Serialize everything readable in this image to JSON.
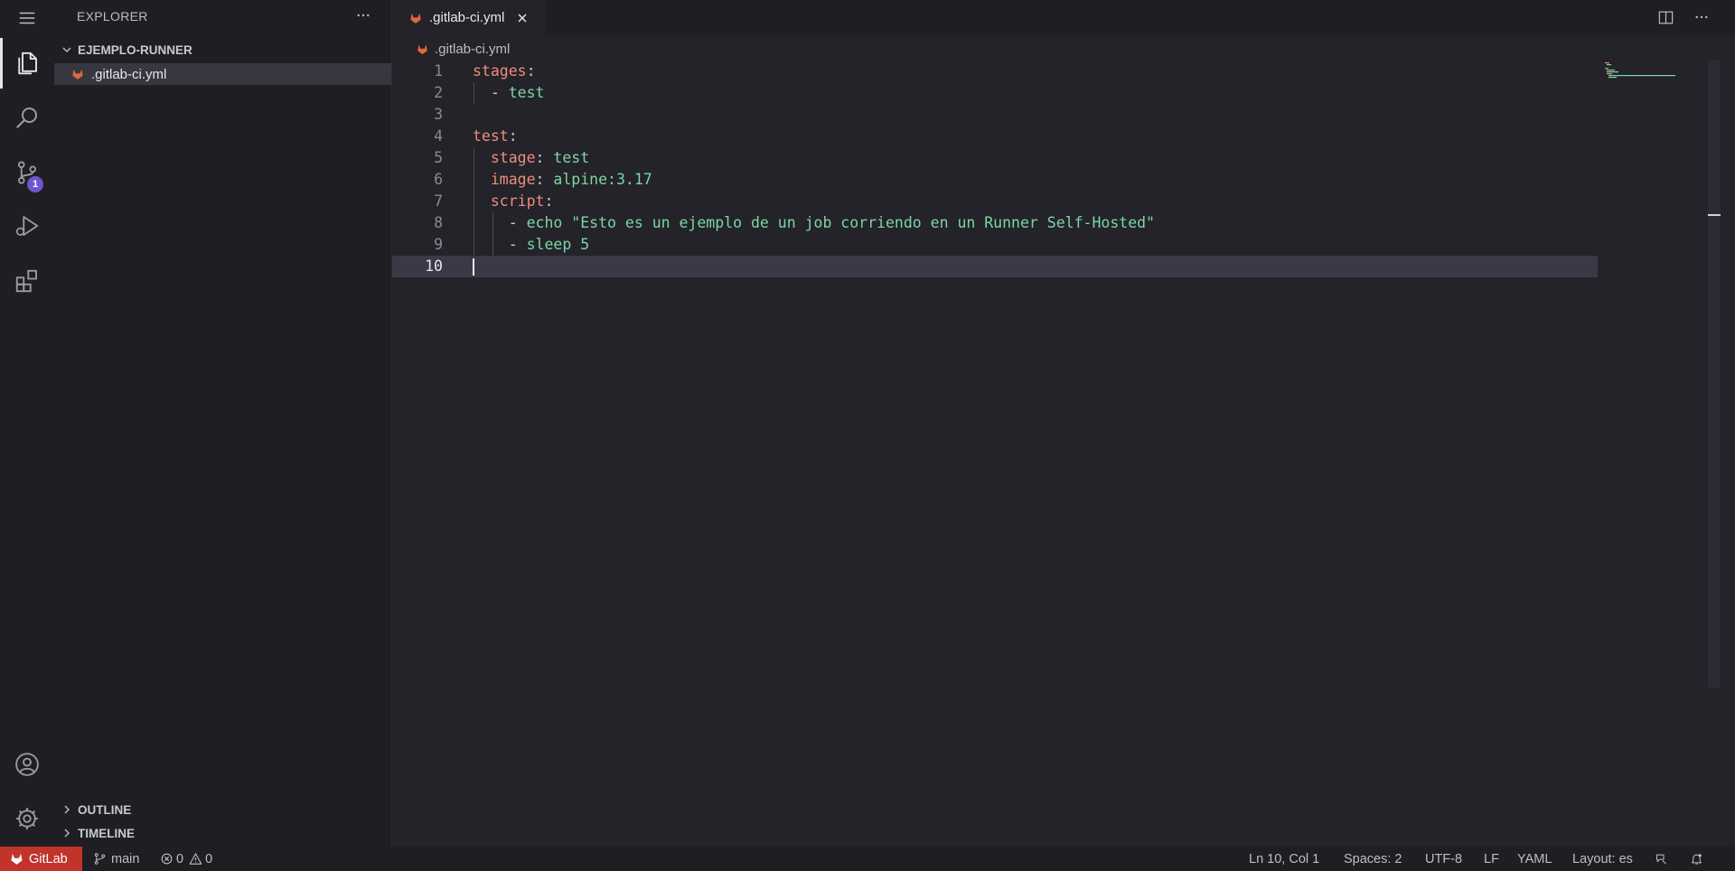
{
  "sidebar": {
    "title": "EXPLORER",
    "folder": "EJEMPLO-RUNNER",
    "file": ".gitlab-ci.yml",
    "outline": "OUTLINE",
    "timeline": "TIMELINE"
  },
  "activity": {
    "scm_badge": "1"
  },
  "tab": {
    "label": ".gitlab-ci.yml"
  },
  "breadcrumb": {
    "file": ".gitlab-ci.yml"
  },
  "editor": {
    "lines": [
      {
        "n": "1",
        "tokens": [
          {
            "t": "stages",
            "c": "k"
          },
          {
            "t": ":",
            "c": "p"
          }
        ]
      },
      {
        "n": "2",
        "tokens": [
          {
            "t": "  ",
            "c": "p"
          },
          {
            "t": "- ",
            "c": "p"
          },
          {
            "t": "test",
            "c": "v"
          }
        ]
      },
      {
        "n": "3",
        "tokens": []
      },
      {
        "n": "4",
        "tokens": [
          {
            "t": "test",
            "c": "k"
          },
          {
            "t": ":",
            "c": "p"
          }
        ]
      },
      {
        "n": "5",
        "tokens": [
          {
            "t": "  ",
            "c": "p"
          },
          {
            "t": "stage",
            "c": "k"
          },
          {
            "t": ": ",
            "c": "p"
          },
          {
            "t": "test",
            "c": "v"
          }
        ]
      },
      {
        "n": "6",
        "tokens": [
          {
            "t": "  ",
            "c": "p"
          },
          {
            "t": "image",
            "c": "k"
          },
          {
            "t": ": ",
            "c": "p"
          },
          {
            "t": "alpine:3.17",
            "c": "v"
          }
        ]
      },
      {
        "n": "7",
        "tokens": [
          {
            "t": "  ",
            "c": "p"
          },
          {
            "t": "script",
            "c": "k"
          },
          {
            "t": ":",
            "c": "p"
          }
        ]
      },
      {
        "n": "8",
        "tokens": [
          {
            "t": "    ",
            "c": "p"
          },
          {
            "t": "- ",
            "c": "p"
          },
          {
            "t": "echo \"Esto es un ejemplo de un job corriendo en un Runner Self-Hosted\"",
            "c": "v"
          }
        ]
      },
      {
        "n": "9",
        "tokens": [
          {
            "t": "    ",
            "c": "p"
          },
          {
            "t": "- ",
            "c": "p"
          },
          {
            "t": "sleep 5",
            "c": "v"
          }
        ]
      },
      {
        "n": "10",
        "tokens": []
      }
    ]
  },
  "status": {
    "gitlab": "GitLab",
    "branch": "main",
    "errors": "0",
    "warnings": "0",
    "position": "Ln 10, Col 1",
    "spaces": "Spaces: 2",
    "encoding": "UTF-8",
    "eol": "LF",
    "language": "YAML",
    "layout": "Layout: es"
  },
  "colors": {
    "accent_gitlab": "#c0342c",
    "key": "#ef8c7e",
    "value": "#7ed5a4",
    "badge": "#6e56cf"
  }
}
